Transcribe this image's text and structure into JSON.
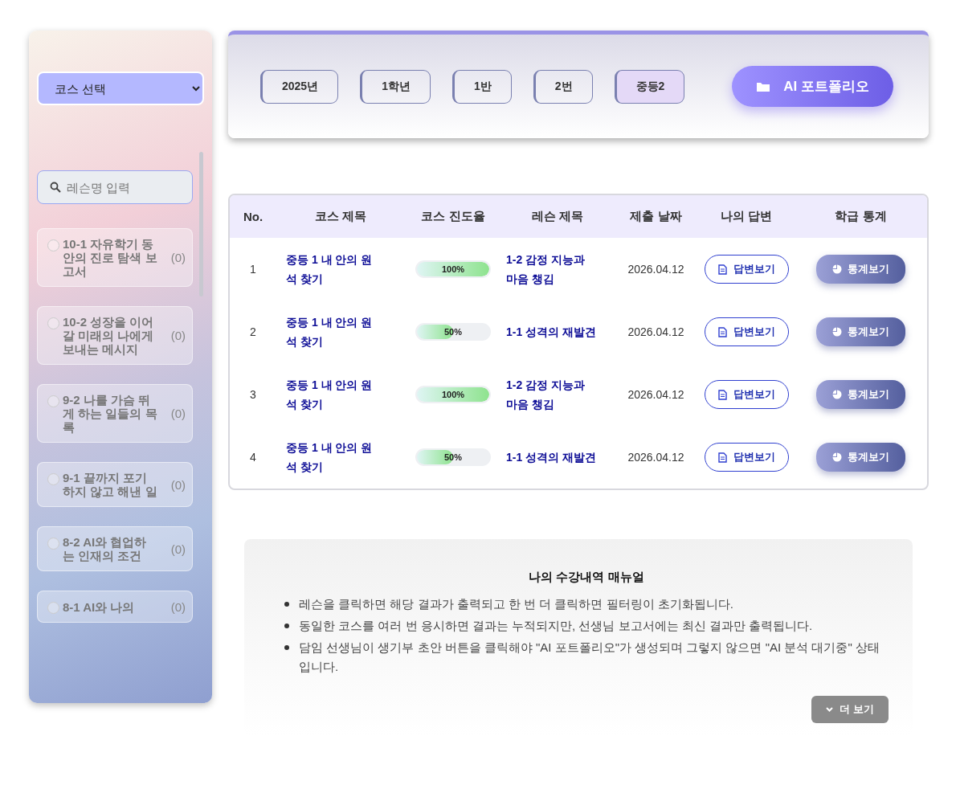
{
  "sidebar": {
    "course_select": {
      "value": "코스 선택"
    },
    "search": {
      "placeholder": "레슨명 입력"
    },
    "lessons": [
      {
        "title": "10-1 자유학기 동안의 진로 탐색 보고서",
        "count": "(0)",
        "selected": false
      },
      {
        "title": "10-2 성장을 이어갈 미래의 나에게 보내는 메시지",
        "count": "(0)",
        "selected": false
      },
      {
        "title": "9-2 나를 가슴 뛰게 하는 일들의 목록",
        "count": "(0)",
        "selected": false
      },
      {
        "title": "9-1 끝까지 포기하지 않고 해낸 일",
        "count": "(0)",
        "selected": false
      },
      {
        "title": "8-2 AI와 협업하는 인재의 조건",
        "count": "(0)",
        "selected": false
      },
      {
        "title": "8-1 AI와 나의",
        "count": "(0)",
        "selected": false
      }
    ]
  },
  "header": {
    "tags": [
      {
        "label": "2025년",
        "selected": false
      },
      {
        "label": "1학년",
        "selected": false
      },
      {
        "label": "1반",
        "selected": false
      },
      {
        "label": "2번",
        "selected": false
      },
      {
        "label": "중등2",
        "selected": true
      }
    ],
    "portfolio_button": "AI 포트폴리오"
  },
  "table": {
    "columns": [
      "No.",
      "코스 제목",
      "코스 진도율",
      "레슨 제목",
      "제출 날짜",
      "나의 답변",
      "학급 통계"
    ],
    "rows": [
      {
        "no": "1",
        "course": "중등 1 내 안의 원석 찾기",
        "level": 1,
        "progress": "100%",
        "lesson": "1-2 감정 지능과 마음 챙김",
        "date": "2026.04.12",
        "answer_button": "답변보기",
        "stats_button": "통계보기"
      },
      {
        "no": "2",
        "course": "중등 1 내 안의 원석 찾기",
        "level": 0.5,
        "progress": "50%",
        "lesson": "1-1 성격의 재발견",
        "date": "2026.04.12",
        "answer_button": "답변보기",
        "stats_button": "통계보기"
      },
      {
        "no": "3",
        "course": "중등 1 내 안의 원석 찾기",
        "level": 1,
        "progress": "100%",
        "lesson": "1-2 감정 지능과 마음 챙김",
        "date": "2026.04.12",
        "answer_button": "답변보기",
        "stats_button": "통계보기"
      },
      {
        "no": "4",
        "course": "중등 1 내 안의 원석 찾기",
        "level": 0.5,
        "progress": "50%",
        "lesson": "1-1 성격의 재발견",
        "date": "2026.04.12",
        "answer_button": "답변보기",
        "stats_button": "통계보기"
      }
    ]
  },
  "manual": {
    "title": "나의 수강내역 매뉴얼",
    "items": [
      "레슨을 클릭하면 해당 결과가 출력되고 한 번 더 클릭하면 필터링이 초기화됩니다.",
      "동일한 코스를 여러 번 응시하면 결과는 누적되지만, 선생님 보고서에는 최신 결과만 출력됩니다.",
      "담임 선생님이 생기부 초안 버튼을 클릭해야 \"AI 포트폴리오\"가 생성되며 그렇지 않으면 \"AI 분석 대기중\" 상태입니다."
    ],
    "more_button": "더 보기"
  }
}
